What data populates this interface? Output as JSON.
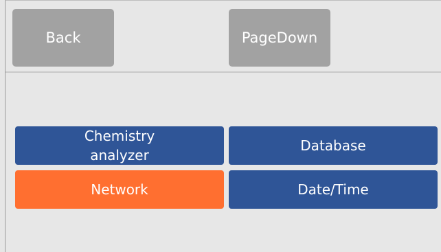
{
  "toolbar": {
    "back_label": "Back",
    "pagedown_label": "PageDown"
  },
  "menu": {
    "items": [
      {
        "label_line1": "Chemistry",
        "label_line2": "analyzer",
        "state": "normal"
      },
      {
        "label": "Database",
        "state": "normal"
      },
      {
        "label": "Network",
        "state": "selected"
      },
      {
        "label": "Date/Time",
        "state": "normal"
      }
    ]
  },
  "colors": {
    "button_normal": "#2f5597",
    "button_selected": "#ff6f30",
    "toolbar_button": "#a2a2a2",
    "background": "#e7e7e7"
  }
}
